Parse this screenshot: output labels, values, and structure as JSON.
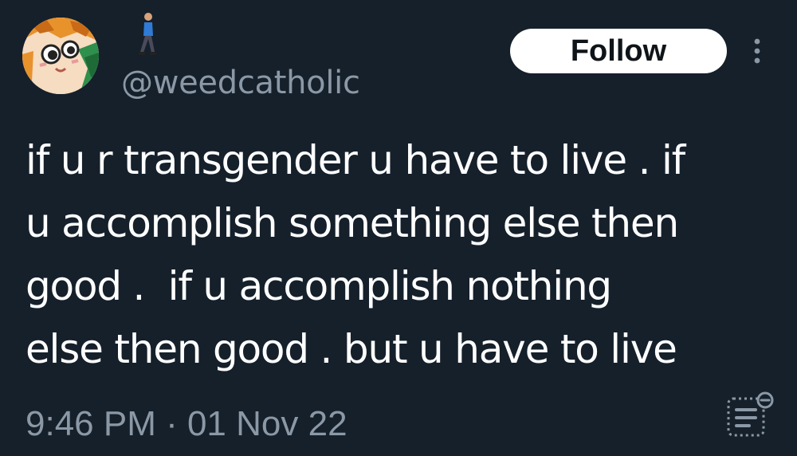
{
  "tweet": {
    "author": {
      "handle": "@weedcatholic",
      "avatar_icon": "pixel-art-cat-avatar",
      "display_name_emoji": "person-walking-emoji"
    },
    "follow_label": "Follow",
    "more_icon": "more-vertical-icon",
    "text": "if u r transgender u have to live . if\nu accomplish something else then\ngood .  if u accomplish nothing\nelse then good . but u have to live",
    "timestamp": "9:46 PM · 01 Nov 22",
    "analytics_icon": "analytics-icon"
  },
  "colors": {
    "background": "#15202b",
    "text": "#ffffff",
    "secondary_text": "#8b98a5",
    "button_bg": "#ffffff",
    "button_text": "#0f1419"
  }
}
